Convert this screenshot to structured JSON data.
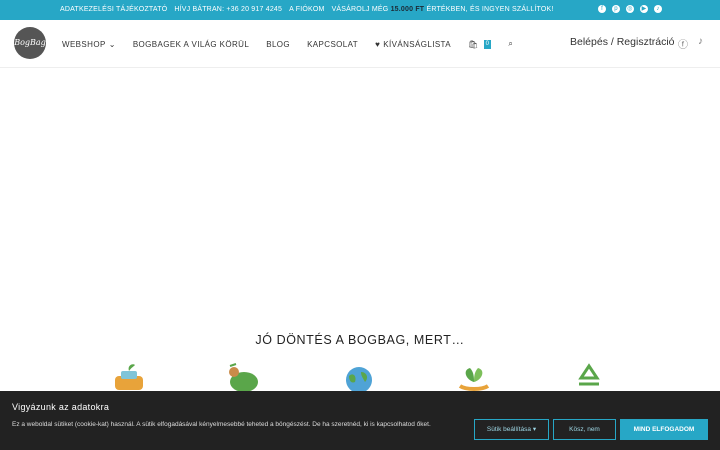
{
  "topbar": {
    "items": [
      "ADATKEZELÉSI TÁJÉKOZTATÓ",
      "HÍVJ BÁTRAN: +36 20 917 4245",
      "A FIÓKOM"
    ],
    "promo_before": "VÁSÁROLJ MÉG",
    "promo_amount": "15.000 FT",
    "promo_after": "ÉRTÉKBEN, ÉS INGYEN SZÁLLÍTOK!"
  },
  "logo_text": "BogBag",
  "menu": {
    "webshop": "WEBSHOP",
    "bogbagek": "BOGBAGEK A VILÁG KÖRÜL",
    "blog": "BLOG",
    "kapcsolat": "KAPCSOLAT",
    "wishlist": "KÍVÁNSÁGLISTA",
    "cart_count": "0"
  },
  "auth": {
    "login": "Belépés",
    "sep": "/",
    "register": "Regisztráció"
  },
  "headline": "JÓ DÖNTÉS A BOGBAG, MERT…",
  "cookie": {
    "title": "Vigyázunk az adatokra",
    "text": "Ez a weboldal sütiket (cookie-kat) használ. A sütik elfogadásával kényelmesebbé teheted a böngészést. De ha szeretnéd, ki is kapcsolhatod őket.",
    "settings": "Sütik beállítása",
    "decline": "Kösz, nem",
    "accept": "MIND ELFOGADOM"
  },
  "colors": {
    "accent": "#27a7c6",
    "dark": "#222222"
  }
}
